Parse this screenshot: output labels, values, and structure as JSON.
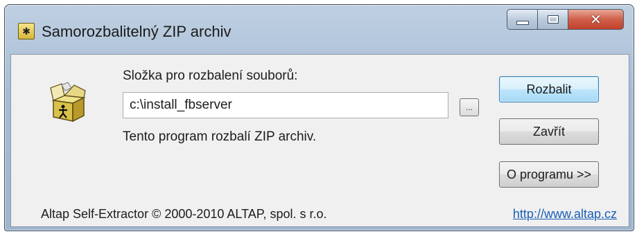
{
  "window": {
    "title": "Samorozbalitelný ZIP archiv"
  },
  "dialog": {
    "folder_label": "Složka pro rozbalení souborů:",
    "folder_value": "c:\\install_fbserver",
    "browse_label": "...",
    "info_text": "Tento program rozbalí ZIP archiv."
  },
  "buttons": {
    "extract": "Rozbalit",
    "close": "Zavřít",
    "about": "O programu >>"
  },
  "footer": {
    "copyright": "Altap Self-Extractor © 2000-2010 ALTAP, spol. s r.o.",
    "link": "http://www.altap.cz"
  },
  "icons": {
    "app": "zip-package-icon",
    "minimize": "minimize-icon",
    "maximize": "maximize-icon",
    "close": "close-icon",
    "package": "open-box-icon"
  },
  "colors": {
    "link": "#1a5fb4",
    "close_button": "#c2412c",
    "default_button": "#3c7fb1"
  }
}
